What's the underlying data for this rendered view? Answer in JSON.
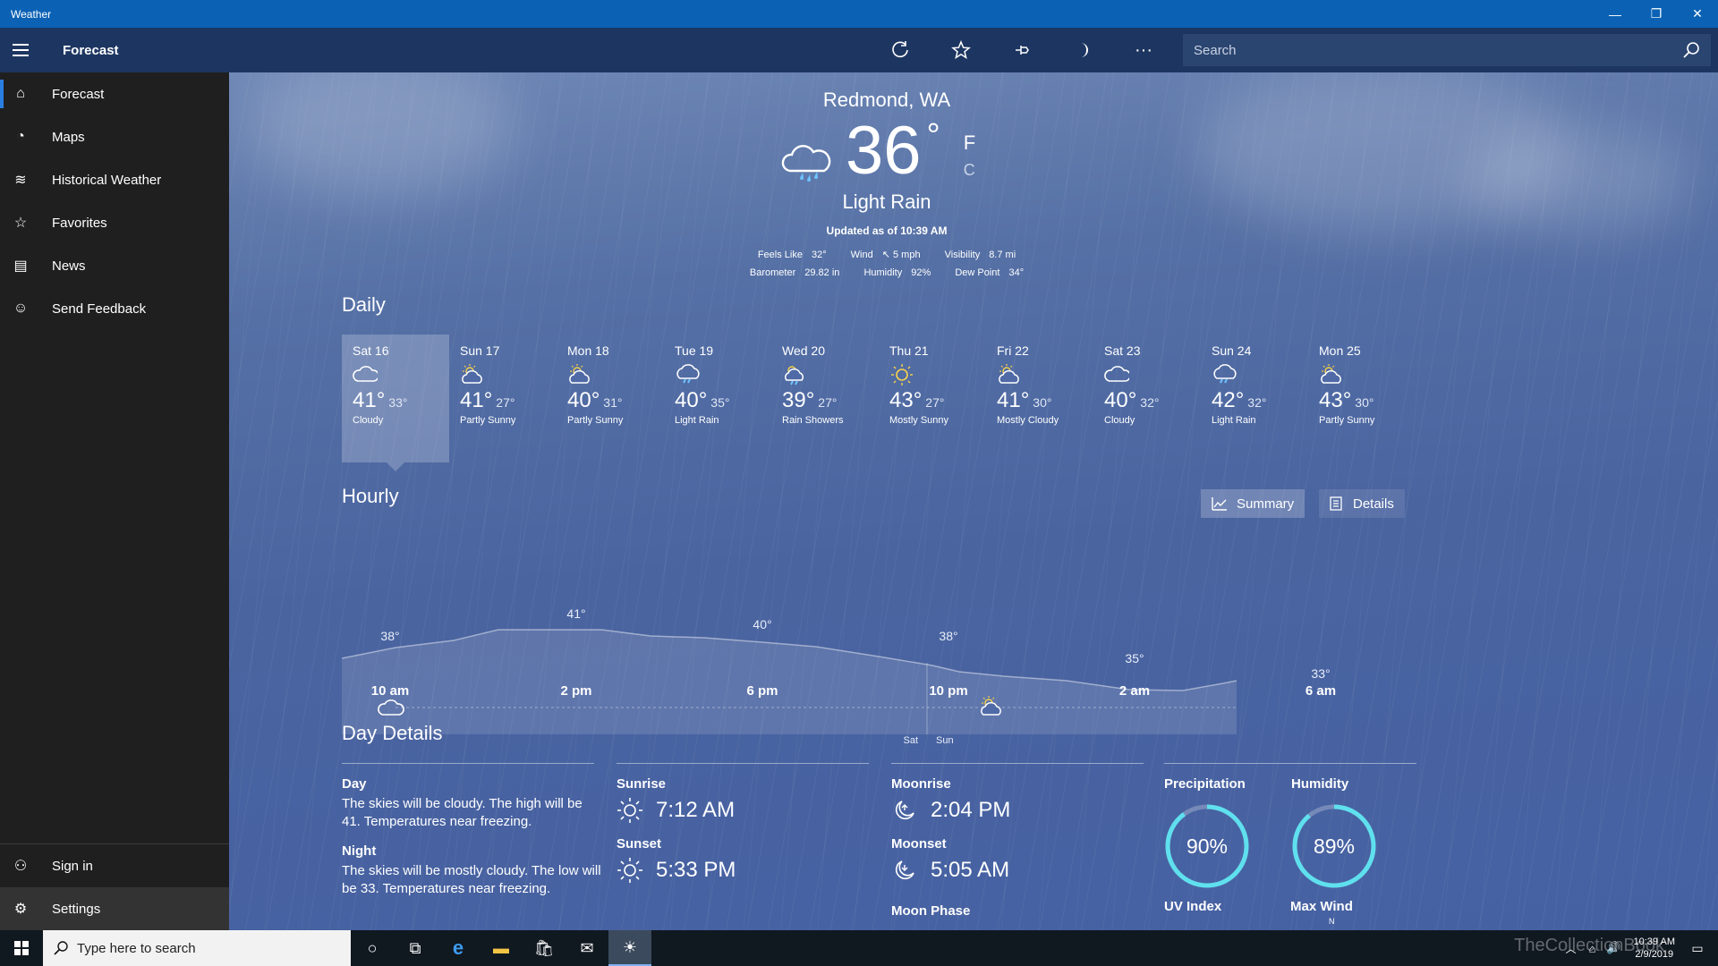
{
  "app": {
    "title": "Weather"
  },
  "window": {
    "min_glyph": "—",
    "restore_glyph": "❐",
    "close_glyph": "✕"
  },
  "cmdbar": {
    "title": "Forecast",
    "search_placeholder": "Search"
  },
  "sidebar": {
    "items": [
      {
        "label": "Forecast",
        "icon": "home-icon"
      },
      {
        "label": "Maps",
        "icon": "radar-icon"
      },
      {
        "label": "Historical Weather",
        "icon": "chart-icon"
      },
      {
        "label": "Favorites",
        "icon": "star-list-icon"
      },
      {
        "label": "News",
        "icon": "news-icon"
      },
      {
        "label": "Send Feedback",
        "icon": "smile-icon"
      }
    ],
    "bottom": [
      {
        "label": "Sign in",
        "icon": "person-icon"
      },
      {
        "label": "Settings",
        "icon": "gear-icon"
      }
    ]
  },
  "current": {
    "location": "Redmond, WA",
    "temp": "36",
    "deg": "°",
    "unit_f": "F",
    "unit_c": "C",
    "condition": "Light Rain",
    "updated": "Updated as of 10:39 AM",
    "metrics_row1": [
      {
        "label": "Feels Like",
        "value": "32°"
      },
      {
        "label": "Wind",
        "value": "↖ 5 mph"
      },
      {
        "label": "Visibility",
        "value": "8.7 mi"
      }
    ],
    "metrics_row2": [
      {
        "label": "Barometer",
        "value": "29.82 in"
      },
      {
        "label": "Humidity",
        "value": "92%"
      },
      {
        "label": "Dew Point",
        "value": "34°"
      }
    ]
  },
  "daily": {
    "title": "Daily",
    "days": [
      {
        "name": "Sat 16",
        "hi": "41°",
        "lo": "33°",
        "cond": "Cloudy",
        "icon": "cloudy"
      },
      {
        "name": "Sun 17",
        "hi": "41°",
        "lo": "27°",
        "cond": "Partly Sunny",
        "icon": "partly-sunny"
      },
      {
        "name": "Mon 18",
        "hi": "40°",
        "lo": "31°",
        "cond": "Partly Sunny",
        "icon": "partly-sunny"
      },
      {
        "name": "Tue 19",
        "hi": "40°",
        "lo": "35°",
        "cond": "Light Rain",
        "icon": "rain"
      },
      {
        "name": "Wed 20",
        "hi": "39°",
        "lo": "27°",
        "cond": "Rain Showers",
        "icon": "showers"
      },
      {
        "name": "Thu 21",
        "hi": "43°",
        "lo": "27°",
        "cond": "Mostly Sunny",
        "icon": "sunny"
      },
      {
        "name": "Fri 22",
        "hi": "41°",
        "lo": "30°",
        "cond": "Mostly Cloudy",
        "icon": "partly-sunny"
      },
      {
        "name": "Sat 23",
        "hi": "40°",
        "lo": "32°",
        "cond": "Cloudy",
        "icon": "cloudy"
      },
      {
        "name": "Sun 24",
        "hi": "42°",
        "lo": "32°",
        "cond": "Light Rain",
        "icon": "rain"
      },
      {
        "name": "Mon 25",
        "hi": "43°",
        "lo": "30°",
        "cond": "Partly Sunny",
        "icon": "partly-sunny"
      }
    ]
  },
  "hourly": {
    "title": "Hourly",
    "summary_label": "Summary",
    "details_label": "Details",
    "time_labels": [
      "10 am",
      "2 pm",
      "6 pm",
      "10 pm",
      "2 am",
      "6 am"
    ],
    "temp_labels": [
      "38°",
      "41°",
      "40°",
      "38°",
      "35°",
      "33°"
    ],
    "day_split": [
      "Sat",
      "Sun"
    ]
  },
  "day_details": {
    "title": "Day Details",
    "day_heading": "Day",
    "day_text": "The skies will be cloudy. The high will be 41. Temperatures near freezing.",
    "night_heading": "Night",
    "night_text": "The skies will be mostly cloudy. The low will be 33. Temperatures near freezing.",
    "sunrise_label": "Sunrise",
    "sunrise": "7:12 AM",
    "sunset_label": "Sunset",
    "sunset": "5:33 PM",
    "moonrise_label": "Moonrise",
    "moonrise": "2:04 PM",
    "moonset_label": "Moonset",
    "moonset": "5:05 AM",
    "moonphase_label": "Moon Phase",
    "precip_label": "Precipitation",
    "precip_value": "90%",
    "precip_fraction": 0.9,
    "humidity_label": "Humidity",
    "humidity_value": "89%",
    "humidity_fraction": 0.89,
    "uv_label": "UV Index",
    "wind_label": "Max Wind",
    "wind_dir": "N"
  },
  "taskbar": {
    "search_placeholder": "Type here to search",
    "time": "10:39 AM",
    "date": "2/9/2019",
    "watermark": "TheCollectionBook"
  },
  "colors": {
    "titlebar": "#0b62b5",
    "cmdbar": "#1d3661",
    "accent": "#2a7de1",
    "ring": "#5fe0ee"
  }
}
